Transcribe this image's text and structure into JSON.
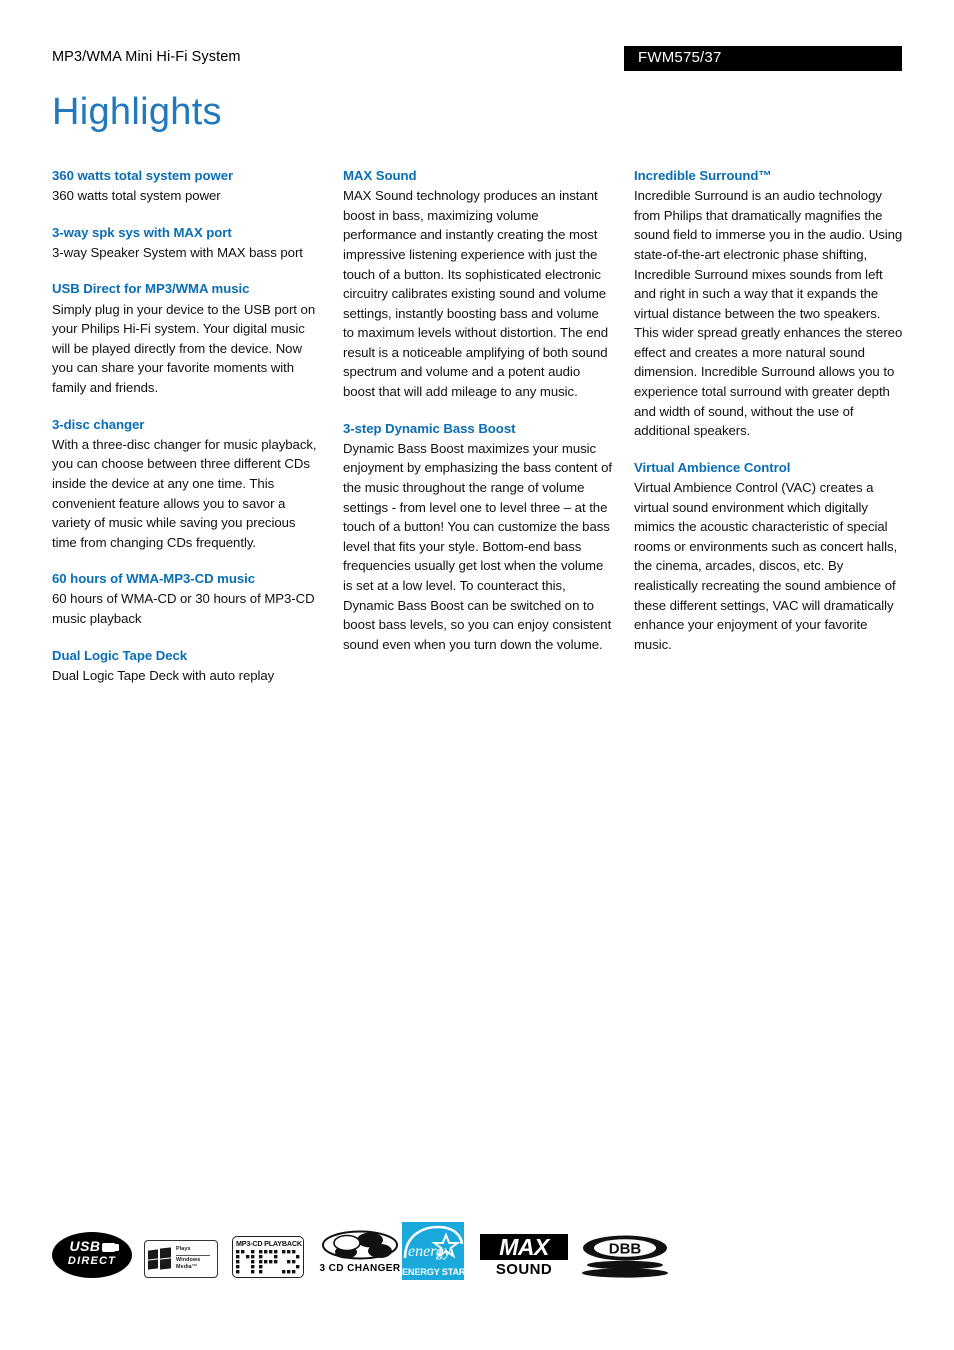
{
  "header": {
    "subtitle": "MP3/WMA Mini Hi-Fi System",
    "model": "FWM575/37"
  },
  "page_title": "Highlights",
  "columns": [
    {
      "features": [
        {
          "title": "360 watts total system power",
          "body": "360 watts total system power"
        },
        {
          "title": "3-way spk sys with MAX port",
          "body": "3-way Speaker System with MAX bass port"
        },
        {
          "title": "USB Direct for MP3/WMA music",
          "body": "Simply plug in your device to the USB port on your Philips Hi-Fi system. Your digital music will be played directly from the device. Now you can share your favorite moments with family and friends."
        },
        {
          "title": "3-disc changer",
          "body": "With a three-disc changer for music playback, you can choose between three different CDs inside the device at any one time. This convenient feature allows you to savor a variety of music while saving you precious time from changing CDs frequently."
        },
        {
          "title": "60 hours of WMA-MP3-CD music",
          "body": "60 hours of WMA-CD or 30 hours of MP3-CD music playback"
        },
        {
          "title": "Dual Logic Tape Deck",
          "body": "Dual Logic Tape Deck with auto replay"
        }
      ]
    },
    {
      "features": [
        {
          "title": "MAX Sound",
          "body": "MAX Sound technology produces an instant boost in bass, maximizing volume performance and instantly creating the most impressive listening experience with just the touch of a button. Its sophisticated electronic circuitry calibrates existing sound and volume settings, instantly boosting bass and volume to maximum levels without distortion. The end result is a noticeable amplifying of both sound spectrum and volume and a potent audio boost that will add mileage to any music."
        },
        {
          "title": "3-step Dynamic Bass Boost",
          "body": "Dynamic Bass Boost maximizes your music enjoyment by emphasizing the bass content of the music throughout the range of volume settings - from level one to level three – at the touch of a button! You can customize the bass level that fits your style. Bottom-end bass frequencies usually get lost when the volume is set at a low level. To counteract this, Dynamic Bass Boost can be switched on to boost bass levels, so you can enjoy consistent sound even when you turn down the volume."
        }
      ]
    },
    {
      "features": [
        {
          "title": "Incredible Surround™",
          "body": "Incredible Surround is an audio technology from Philips that dramatically magnifies the sound field to immerse you in the audio. Using state-of-the-art electronic phase shifting, Incredible Surround mixes sounds from left and right in such a way that it expands the virtual distance between the two speakers. This wider spread greatly enhances the stereo effect and creates a more natural sound dimension. Incredible Surround allows you to experience total surround with greater depth and width of sound, without the use of additional speakers."
        },
        {
          "title": "Virtual Ambience Control",
          "body": "Virtual Ambience Control (VAC) creates a virtual sound environment which digitally mimics the acoustic characteristic of special rooms or environments such as concert halls, the cinema, arcades, discos, etc. By realistically recreating the sound ambience of these different settings, VAC will dramatically enhance your enjoyment of your favorite music."
        }
      ]
    }
  ],
  "logos": {
    "usb": {
      "top": "USB",
      "bottom": "DIRECT"
    },
    "windows_media": {
      "plays": "Plays",
      "windows": "Windows",
      "media": "Media™"
    },
    "mp3_cd": {
      "caption": "MP3-CD PLAYBACK",
      "wordmark": "MP3"
    },
    "cd_changer": {
      "caption": "3 CD CHANGER"
    },
    "energy_star": {
      "script": "energy",
      "banner": "ENERGY STAR"
    },
    "max_sound": {
      "max": "MAX",
      "sound": "SOUND"
    },
    "dbb": {
      "label": "DBB"
    }
  },
  "colors": {
    "heading_blue": "#0a6eb4",
    "title_blue": "#2079be",
    "energy_star_cyan": "#1ba9dc",
    "bar_black": "#000000"
  }
}
